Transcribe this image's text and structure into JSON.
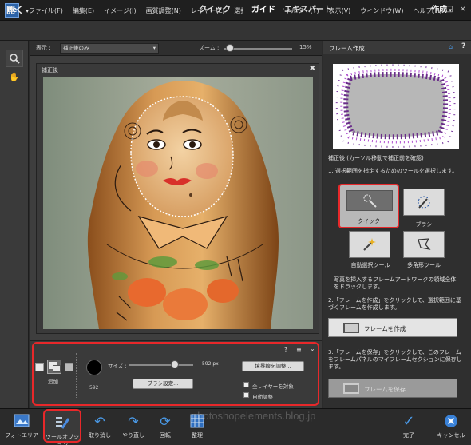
{
  "menu": [
    "ファイル(F)",
    "編集(E)",
    "イメージ(I)",
    "画質調整(N)",
    "レイヤー(L)",
    "選択範囲(S)",
    "フィルター(T)",
    "表示(V)",
    "ウィンドウ(W)",
    "ヘルプ(H)"
  ],
  "modebar": {
    "open": "開く",
    "quick": "クイック",
    "guide": "ガイド",
    "expert": "エキスパート",
    "create": "作成"
  },
  "view": {
    "label": "表示 :",
    "selected": "補正後のみ",
    "zoom_label": "ズーム :",
    "zoom_value": "15%",
    "zoom_fraction": 0.05
  },
  "doc": {
    "title": "補正後"
  },
  "options": {
    "add_label": "追加",
    "size_label": "サイズ :",
    "size_value": "592 px",
    "brush_number": "592",
    "brush_settings": "ブラシ設定...",
    "refine_edge": "境界線を調整...",
    "all_layers": "全レイヤーを対象",
    "auto_enhance": "自動調整",
    "size_fraction": 0.72
  },
  "panel": {
    "title": "フレーム作成",
    "intro": "補正後 (カーソル移動で補正前を確認)",
    "step1": "1. 選択範囲を指定するためのツールを選択します。",
    "tools": [
      "クイック",
      "ブラシ",
      "自動選択ツール",
      "多角形ツール"
    ],
    "hint": "写真を挿入するフレームアートワークの領域全体をドラッグします。",
    "step2": "2.「フレームを作成」をクリックして、選択範囲に基づくフレームを作成します。",
    "create_frame": "フレームを作成",
    "step3": "3.「フレームを保存」をクリックして、このフレームをフレームパネルのマイフレームセクションに保存します。",
    "save_frame": "フレームを保存"
  },
  "taskbar": [
    "フォトエリア",
    "ツールオプション",
    "取り消し",
    "やり直し",
    "回転",
    "整理",
    "完了",
    "キャンセル"
  ],
  "watermark": "photoshopelements.blog.jp",
  "colors": {
    "highlight": "#e8282a",
    "accent": "#2c63a8"
  }
}
